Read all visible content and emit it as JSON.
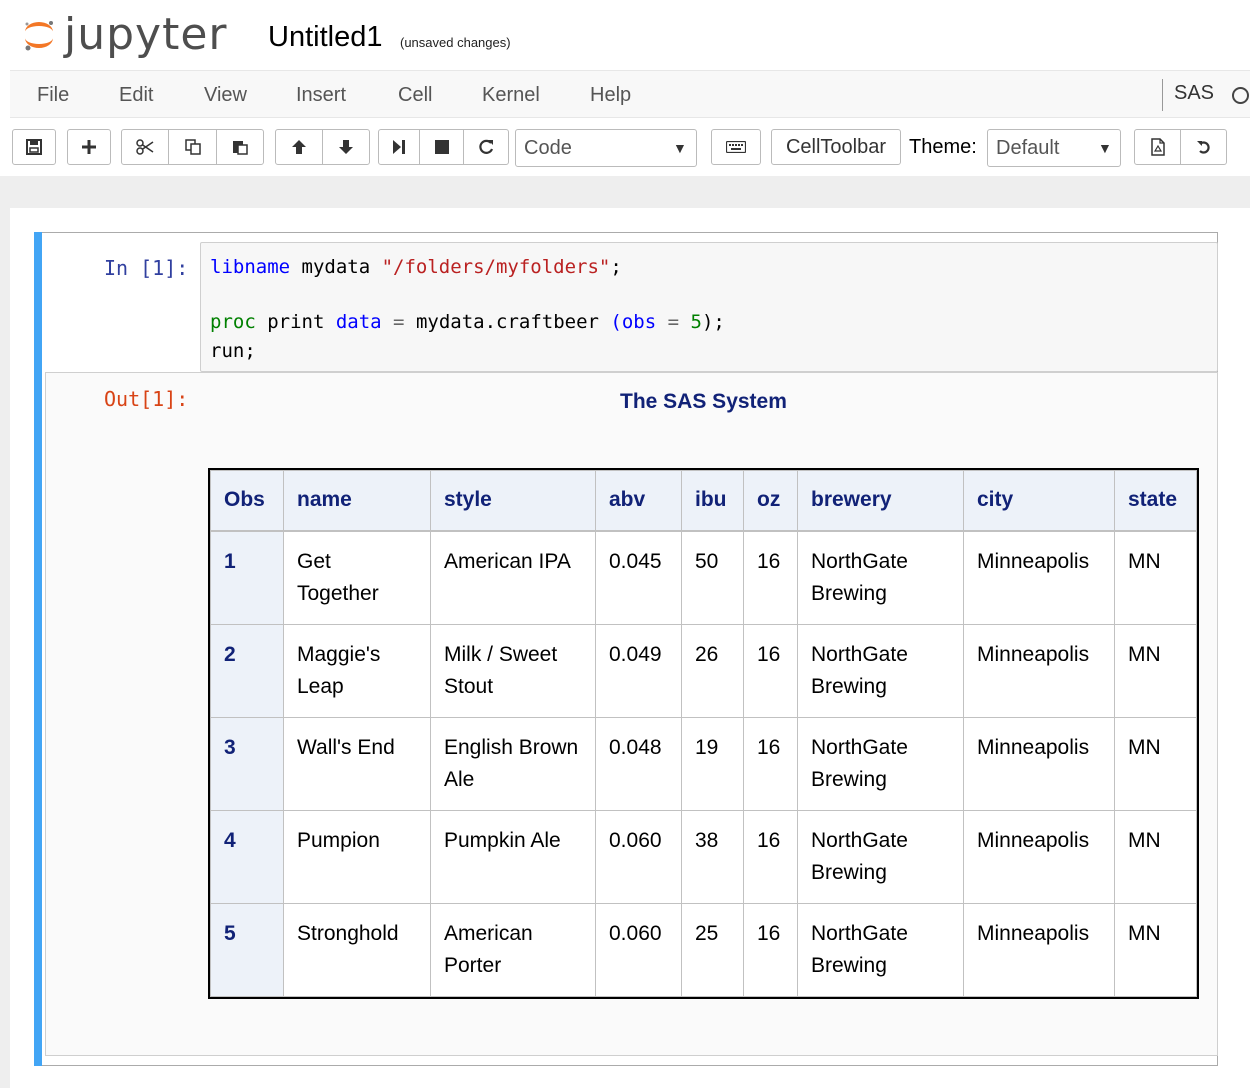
{
  "header": {
    "logo_text": "jupyter",
    "notebook_name": "Untitled1",
    "save_status": "(unsaved changes)"
  },
  "menu": {
    "items": [
      "File",
      "Edit",
      "View",
      "Insert",
      "Cell",
      "Kernel",
      "Help"
    ],
    "kernel_name": "SAS"
  },
  "toolbar": {
    "cell_type": "Code",
    "celltoolbar_label": "CellToolbar",
    "theme_label": "Theme:",
    "theme_value": "Default",
    "icons": [
      "save-icon",
      "add-cell-icon",
      "cut-icon",
      "copy-icon",
      "paste-icon",
      "move-up-icon",
      "move-down-icon",
      "run-icon",
      "stop-icon",
      "restart-icon",
      "keyboard-icon",
      "export-icon",
      "reset-icon"
    ]
  },
  "cell": {
    "in_prompt": "In [1]:",
    "out_prompt": "Out[1]:",
    "code": {
      "line1": {
        "kw": "libname",
        "rest": " mydata ",
        "str": "\"/folders/myfolders\"",
        "end": ";"
      },
      "line2": {
        "kw": "proc",
        "mid": " print ",
        "kw2": "data",
        "eq": " = ",
        "ds": "mydata.craftbeer ",
        "paren_open": "(",
        "kw3": "obs",
        "eq2": " = ",
        "num": "5",
        "end": ");"
      },
      "line3": "run;"
    }
  },
  "output": {
    "title": "The SAS System",
    "table": {
      "columns": [
        "Obs",
        "name",
        "style",
        "abv",
        "ibu",
        "oz",
        "brewery",
        "city",
        "state"
      ],
      "rows": [
        [
          "1",
          "Get Together",
          "American IPA",
          "0.045",
          "50",
          "16",
          "NorthGate Brewing",
          "Minneapolis",
          "MN"
        ],
        [
          "2",
          "Maggie's Leap",
          "Milk / Sweet Stout",
          "0.049",
          "26",
          "16",
          "NorthGate Brewing",
          "Minneapolis",
          "MN"
        ],
        [
          "3",
          "Wall's End",
          "English Brown Ale",
          "0.048",
          "19",
          "16",
          "NorthGate Brewing",
          "Minneapolis",
          "MN"
        ],
        [
          "4",
          "Pumpion",
          "Pumpkin Ale",
          "0.060",
          "38",
          "16",
          "NorthGate Brewing",
          "Minneapolis",
          "MN"
        ],
        [
          "5",
          "Stronghold",
          "American Porter",
          "0.060",
          "25",
          "16",
          "NorthGate Brewing",
          "Minneapolis",
          "MN"
        ]
      ]
    }
  },
  "colors": {
    "selected_cell_bar": "#42a5f5",
    "in_prompt": "#303f9f",
    "out_prompt": "#d84315",
    "sas_header_bg": "#edf2f9",
    "sas_header_text": "#112277"
  }
}
